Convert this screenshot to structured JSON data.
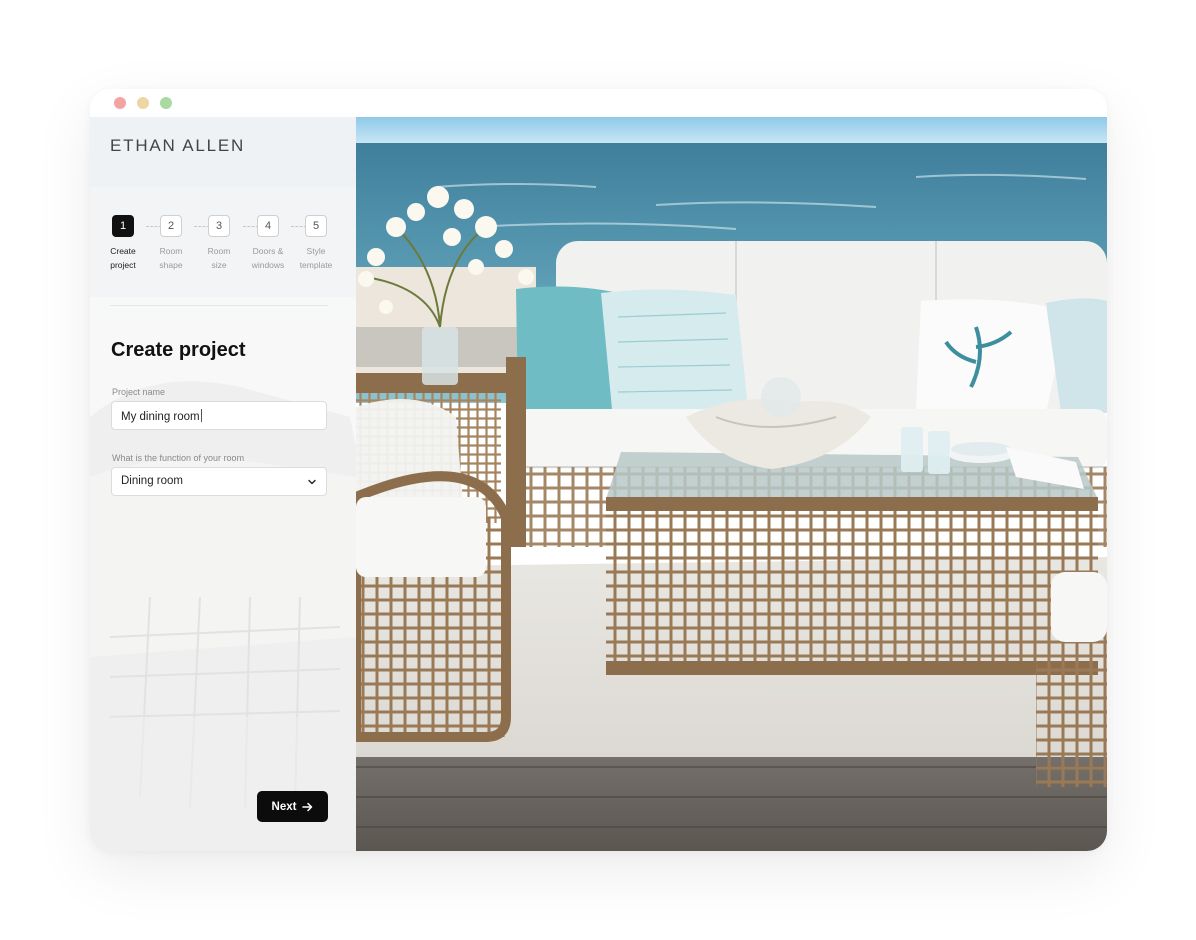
{
  "window": {
    "controls": [
      "close",
      "minimize",
      "maximize"
    ]
  },
  "brand": {
    "logo": "ETHAN ALLEN"
  },
  "steps": [
    {
      "number": "1",
      "label_line1": "Create",
      "label_line2": "project",
      "active": true
    },
    {
      "number": "2",
      "label_line1": "Room",
      "label_line2": "shape",
      "active": false
    },
    {
      "number": "3",
      "label_line1": "Room",
      "label_line2": "size",
      "active": false
    },
    {
      "number": "4",
      "label_line1": "Doors &",
      "label_line2": "windows",
      "active": false
    },
    {
      "number": "5",
      "label_line1": "Style",
      "label_line2": "template",
      "active": false
    }
  ],
  "form": {
    "title": "Create project",
    "project_name": {
      "label": "Project name",
      "value": "My dining room"
    },
    "room_function": {
      "label": "What is the function of your room",
      "value": "Dining room"
    }
  },
  "actions": {
    "next_label": "Next"
  },
  "icons": {
    "next": "arrow-right-icon",
    "select": "chevron-down-icon"
  },
  "colors": {
    "accent": "#0c0c0c",
    "sea": "#4f8fa8",
    "sky": "#9fd0ea",
    "cushion": "#f2f2f0",
    "pillow_teal": "#6fbcc4"
  }
}
